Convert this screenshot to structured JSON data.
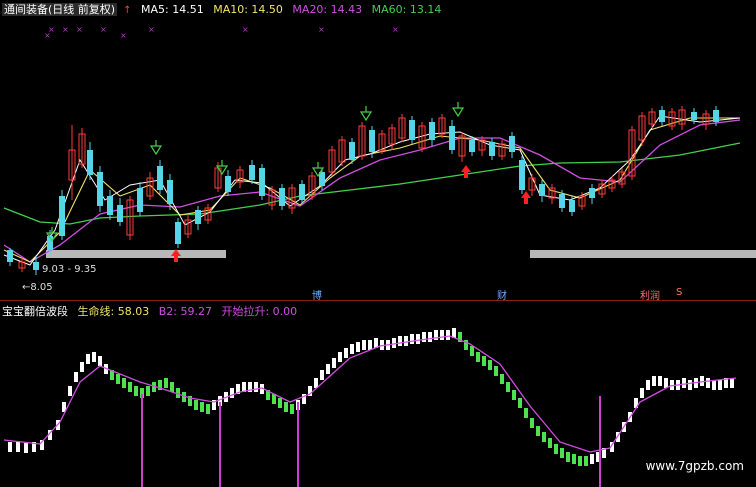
{
  "top_header": {
    "title": "通间装备(日线 前复权)",
    "ma5_label": "MA5: 14.51",
    "ma10_label": "MA10: 14.50",
    "ma20_label": "MA20: 14.43",
    "ma60_label": "MA60: 13.14",
    "up_arrow": "↑"
  },
  "price_annotations": {
    "range_label": "9.03 - 9.35",
    "low_label": "←8.05"
  },
  "date_markers": {
    "marker1": "博",
    "marker2": "财",
    "marker3": "利润",
    "marker4": "S"
  },
  "bottom_header": {
    "title": "宝宝翻倍波段",
    "life_line": "生命线: 58.03",
    "b2": "B2: 59.27",
    "rise": "开始拉升: 0.00",
    "up_arrow": "↑"
  },
  "watermark": "www.7gpzb.com",
  "colors": {
    "up": "#ff3c3c",
    "down": "#55d6e6",
    "ma5": "#ffffff",
    "ma10": "#f2e36a",
    "ma20": "#d04fe0",
    "ma60": "#43d14d",
    "bar_white": "#ffffff",
    "bar_green": "#4ee04e",
    "signal": "#d040d0"
  }
}
